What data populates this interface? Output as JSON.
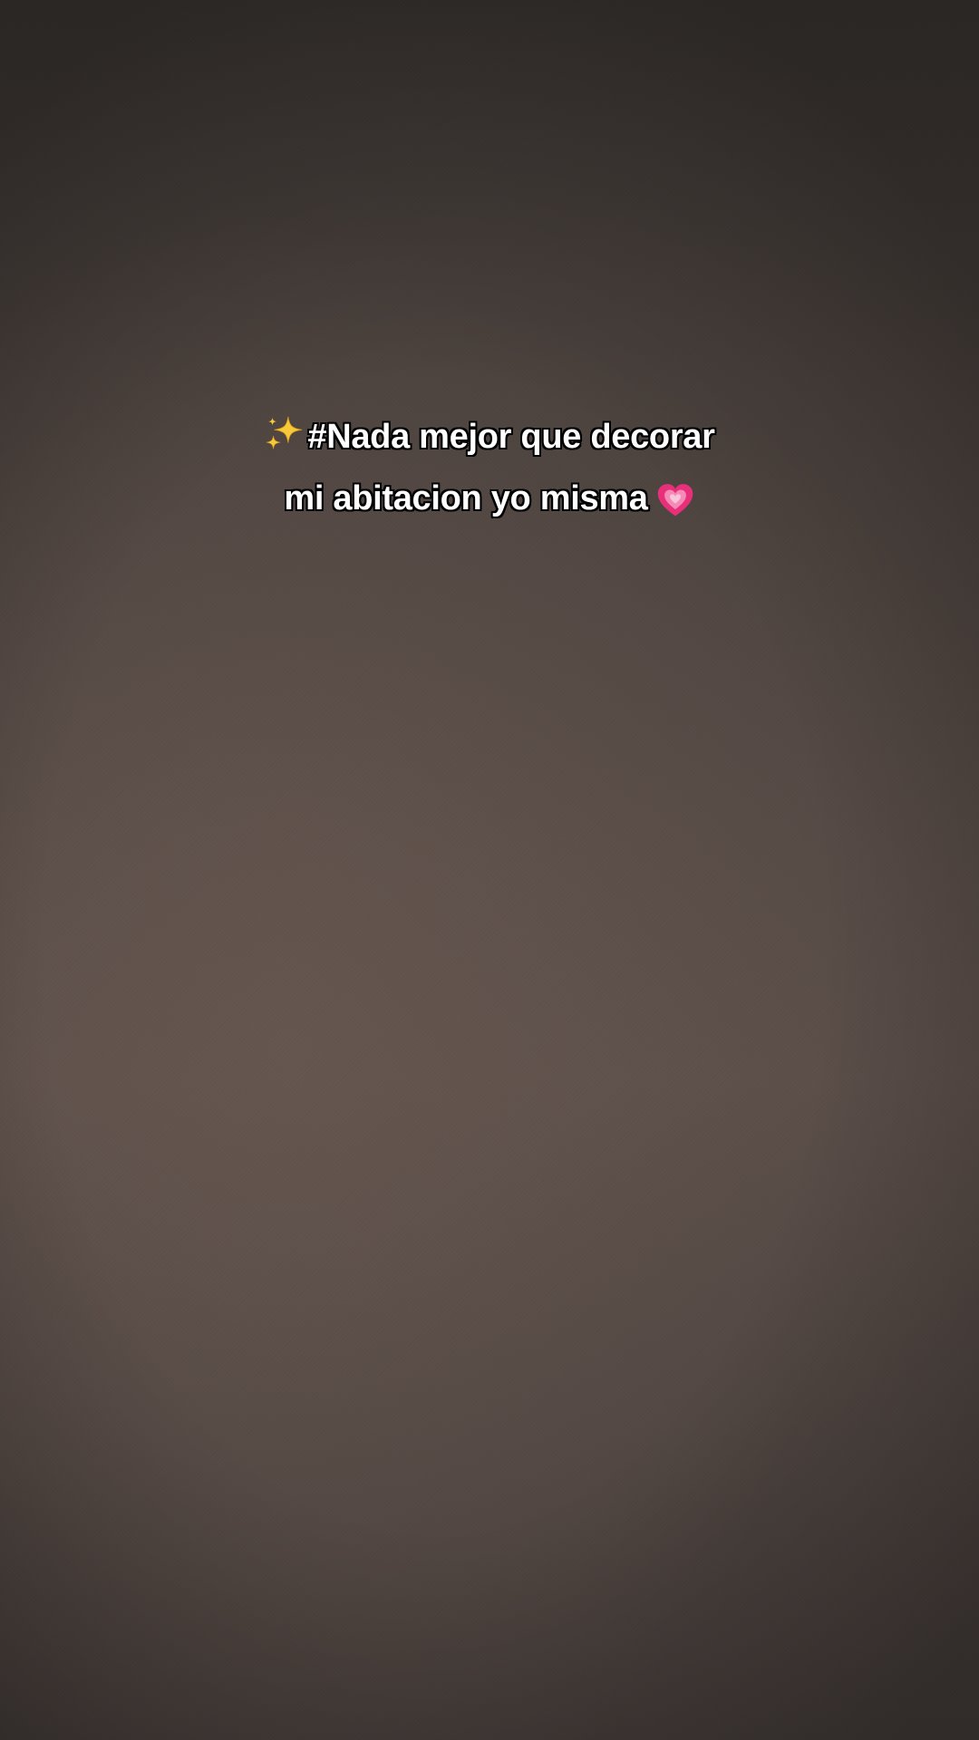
{
  "caption": {
    "line1_text": "#Nada mejor que decorar",
    "line2_text": "mi abitacion yo misma",
    "leading_icon": "sparkles-icon",
    "trailing_icon": "growing-heart-icon"
  },
  "colors": {
    "caption_text": "#ffffff",
    "caption_outline": "#000000",
    "background": "#4a403c",
    "heart": "#e8307a",
    "sparkles": "#f7c93a"
  }
}
